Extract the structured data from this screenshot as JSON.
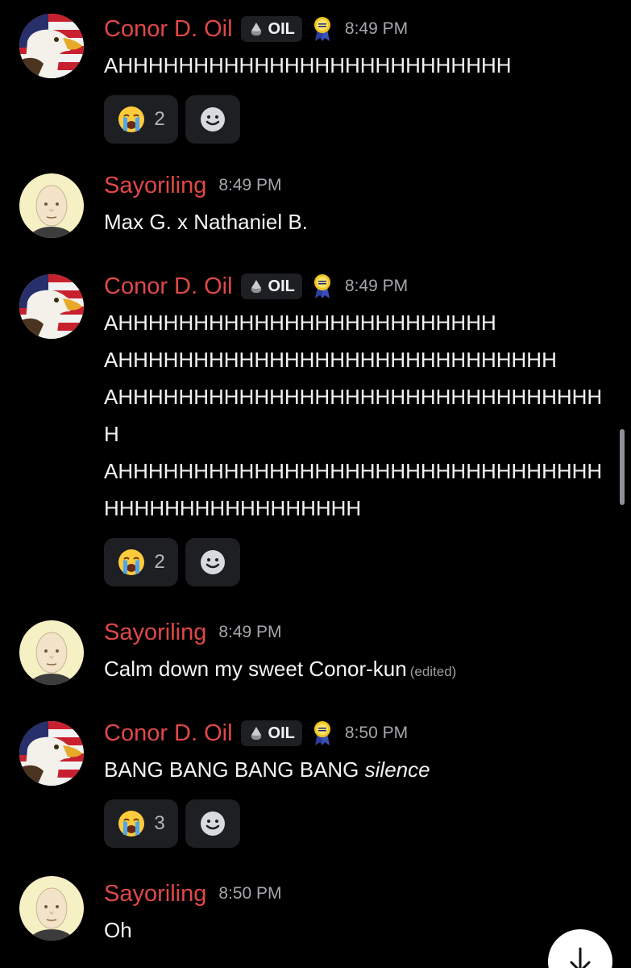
{
  "users": {
    "conor": {
      "name": "Conor D. Oil",
      "tag": "OIL"
    },
    "sayo": {
      "name": "Sayoriling"
    }
  },
  "messages": [
    {
      "time": "8:49 PM",
      "lines": [
        "AHHHHHHHHHHHHHHHHHHHHHHHHHH"
      ],
      "reaction_count": "2"
    },
    {
      "time": "8:49 PM",
      "lines": [
        "Max G. x Nathaniel B."
      ]
    },
    {
      "time": "8:49 PM",
      "lines": [
        "AHHHHHHHHHHHHHHHHHHHHHHHHH",
        "AHHHHHHHHHHHHHHHHHHHHHHHHHHHHH",
        "AHHHHHHHHHHHHHHHHHHHHHHHHHHHHHHHHH",
        "AHHHHHHHHHHHHHHHHHHHHHHHHHHHHHHHHHHHHHHHHHHHHHHHHH"
      ],
      "reaction_count": "2"
    },
    {
      "time": "8:49 PM",
      "text": "Calm down my sweet Conor-kun",
      "edited": "(edited)"
    },
    {
      "time": "8:50 PM",
      "text": "BANG BANG BANG BANG",
      "italic": "silence",
      "reaction_count": "3"
    },
    {
      "time": "8:50 PM",
      "text": "Oh"
    }
  ],
  "icons": {
    "reaction": "loudly-crying-face-icon",
    "add_reaction": "smile-icon",
    "badge": "award-ribbon-icon",
    "tag_icon": "oil-drop-icon",
    "jump": "arrow-down-icon"
  },
  "colors": {
    "username": "#e04848",
    "background": "#000000",
    "pill": "#1e1f22",
    "timestamp": "#a5a7ad"
  }
}
